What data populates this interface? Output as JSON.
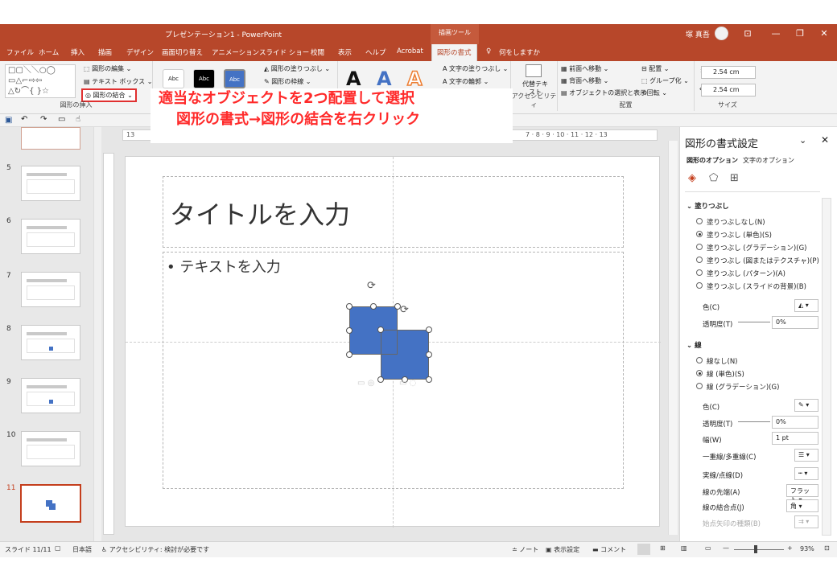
{
  "titlebar": {
    "document_title": "プレゼンテーション1  -  PowerPoint",
    "context_label": "描画ツール",
    "user_name": "塚 真吾",
    "window_buttons": [
      "⊡",
      "—",
      "❐",
      "✕"
    ]
  },
  "tabs": [
    {
      "label": "ファイル"
    },
    {
      "label": "ホーム"
    },
    {
      "label": "挿入"
    },
    {
      "label": "描画"
    },
    {
      "label": "デザイン"
    },
    {
      "label": "画面切り替え"
    },
    {
      "label": "アニメーション"
    },
    {
      "label": "スライド ショー"
    },
    {
      "label": "校閲"
    },
    {
      "label": "表示"
    },
    {
      "label": "ヘルプ"
    },
    {
      "label": "Acrobat"
    },
    {
      "label": "図形の書式"
    }
  ],
  "tell_me": "何をしますか",
  "ribbon": {
    "insert_shapes": {
      "edit_shape": "図形の編集",
      "text_box": "テキスト ボックス",
      "merge_shapes": "図形の結合",
      "label": "図形の挿入"
    },
    "shape_styles": {
      "style_labels": [
        "Abc",
        "Abc",
        "Abc"
      ],
      "fill": "図形の塗りつぶし",
      "outline": "図形の枠線"
    },
    "wordart": {
      "letters": [
        "A",
        "A",
        "A"
      ],
      "text_fill": "文字の塗りつぶし",
      "text_outline": "文字の輪郭"
    },
    "accessibility": {
      "alt_text": "代替テキスト",
      "label": "アクセシビリティ"
    },
    "arrange": {
      "bring_forward": "前面へ移動",
      "send_backward": "背面へ移動",
      "selection_pane": "オブジェクトの選択と表示",
      "align": "配置",
      "group": "グループ化",
      "rotate": "回転",
      "label": "配置"
    },
    "size": {
      "height": "2.54 cm",
      "width": "2.54 cm",
      "label": "サイズ"
    }
  },
  "ruler_numbers": "13",
  "ruler_numbers_right": "7  ·  8  ·  9  ·  10  ·  11  ·  12  ·  13",
  "callout": {
    "line1": "適当なオブジェクトを2つ配置して選択",
    "line2": "図形の書式→図形の結合を右クリック"
  },
  "thumbnails": [
    {
      "number": "5"
    },
    {
      "number": "6"
    },
    {
      "number": "7"
    },
    {
      "number": "8"
    },
    {
      "number": "9"
    },
    {
      "number": "10"
    },
    {
      "number": "11"
    }
  ],
  "slide": {
    "title_placeholder": "タイトルを入力",
    "body_placeholder": "• テキストを入力"
  },
  "format_pane": {
    "title": "図形の書式設定",
    "tab_shape_options": "図形のオプション",
    "tab_text_options": "文字のオプション",
    "fill_section": "塗りつぶし",
    "fill_options": [
      {
        "label": "塗りつぶしなし(N)",
        "selected": false
      },
      {
        "label": "塗りつぶし (単色)(S)",
        "selected": true
      },
      {
        "label": "塗りつぶし (グラデーション)(G)",
        "selected": false
      },
      {
        "label": "塗りつぶし (図またはテクスチャ)(P)",
        "selected": false
      },
      {
        "label": "塗りつぶし (パターン)(A)",
        "selected": false
      },
      {
        "label": "塗りつぶし (スライドの背景)(B)",
        "selected": false
      }
    ],
    "fill_color_label": "色(C)",
    "fill_transparency_label": "透明度(T)",
    "fill_transparency_value": "0%",
    "line_section": "線",
    "line_options": [
      {
        "label": "線なし(N)",
        "selected": false
      },
      {
        "label": "線 (単色)(S)",
        "selected": true
      },
      {
        "label": "線 (グラデーション)(G)",
        "selected": false
      }
    ],
    "line_color_label": "色(C)",
    "line_transparency_label": "透明度(T)",
    "line_transparency_value": "0%",
    "width_label": "幅(W)",
    "width_value": "1 pt",
    "compound_label": "一重線/多重線(C)",
    "dash_label": "実線/点線(D)",
    "cap_label": "線の先端(A)",
    "cap_value": "フラット",
    "join_label": "線の結合点(J)",
    "join_value": "角",
    "arrow_label": "始点矢印の種類(B)"
  },
  "statusbar": {
    "slide_info": "スライド 11/11",
    "language": "日本語",
    "accessibility": "アクセシビリティ: 検討が必要です",
    "notes": "ノート",
    "display_settings": "表示設定",
    "comments": "コメント",
    "zoom": "93%"
  },
  "colors": {
    "accent": "#b7472a",
    "shape_fill": "#4472c4",
    "callout_text": "#ff2a2a",
    "highlight_box": "#e03030"
  }
}
